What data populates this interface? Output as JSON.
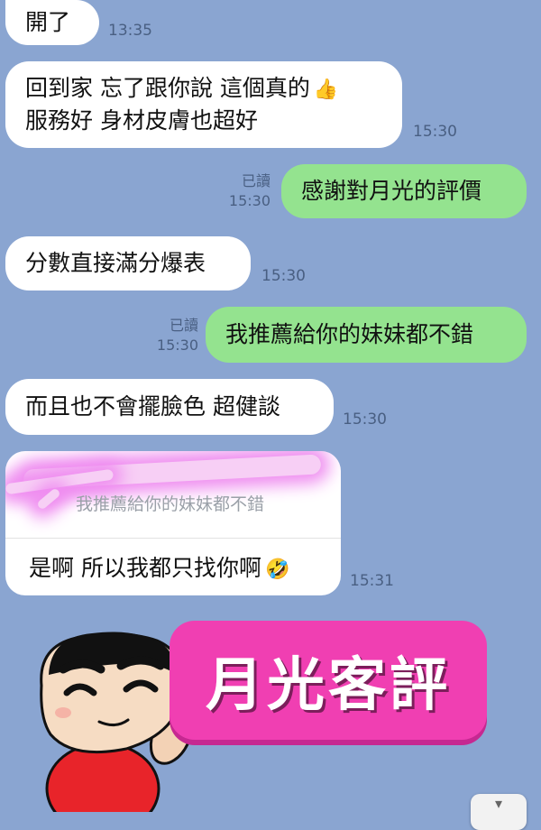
{
  "messages": [
    {
      "text": "開了",
      "time": "13:35"
    },
    {
      "line1": "回到家 忘了跟你說 這個真的",
      "line2": "服務好 身材皮膚也超好",
      "time": "15:30",
      "emoji": "👍"
    },
    {
      "text": "感謝對月光的評價",
      "read": "已讀",
      "time": "15:30"
    },
    {
      "text": "分數直接滿分爆表",
      "time": "15:30"
    },
    {
      "text": "我推薦給你的妹妹都不錯",
      "read": "已讀",
      "time": "15:30"
    },
    {
      "text": "而且也不會擺臉色 超健談",
      "time": "15:30"
    }
  ],
  "reply": {
    "quoted_text": "我推薦給你的妹妹都不錯",
    "text": "是啊 所以我都只找你啊",
    "emoji": "🤣",
    "time": "15:31"
  },
  "banner": {
    "text": "月光客評"
  },
  "scroll_button": {
    "glyph": "▾"
  },
  "colors": {
    "background": "#8aa5d1",
    "incoming": "#ffffff",
    "outgoing": "#94e38f",
    "banner": "#f03fb2"
  }
}
